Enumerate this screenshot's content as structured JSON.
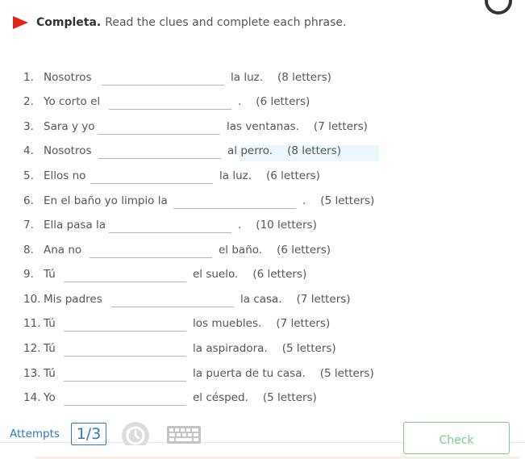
{
  "header": {
    "title": "Completa.",
    "instructions": "Read the clues and complete each phrase."
  },
  "items": [
    {
      "number": "1.",
      "before": "Nosotros",
      "after": "la luz.",
      "hint": "(8 letters)",
      "value": ""
    },
    {
      "number": "2.",
      "before": "Yo corto el",
      "after": ".",
      "hint": "(6 letters)",
      "value": ""
    },
    {
      "number": "3.",
      "before": "Sara y yo",
      "after": "las ventanas.",
      "hint": "(7 letters)",
      "value": ""
    },
    {
      "number": "4.",
      "before": "Nosotros",
      "after": "al perro.",
      "hint": "(8 letters)",
      "value": ""
    },
    {
      "number": "5.",
      "before": "Ellos no",
      "after": "la luz.",
      "hint": "(6 letters)",
      "value": ""
    },
    {
      "number": "6.",
      "before": "En el baño yo limpio la",
      "after": ".",
      "hint": "(5 letters)",
      "value": ""
    },
    {
      "number": "7.",
      "before": "Ella pasa la",
      "after": ".",
      "hint": "(10 letters)",
      "value": ""
    },
    {
      "number": "8.",
      "before": "Ana no",
      "after": "el baño.",
      "hint": "(6 letters)",
      "value": ""
    },
    {
      "number": "9.",
      "before": "Tú",
      "after": "el suelo.",
      "hint": "(6 letters)",
      "value": ""
    },
    {
      "number": "10.",
      "before": "Mis padres",
      "after": "la casa.",
      "hint": "(7 letters)",
      "value": ""
    },
    {
      "number": "11.",
      "before": "Tú",
      "after": "los muebles.",
      "hint": "(7 letters)",
      "value": ""
    },
    {
      "number": "12.",
      "before": "Tú",
      "after": "la aspiradora.",
      "hint": "(5 letters)",
      "value": ""
    },
    {
      "number": "13.",
      "before": "Tú",
      "after": "la puerta de tu casa.",
      "hint": "(5 letters)",
      "value": ""
    },
    {
      "number": "14.",
      "before": "Yo",
      "after": "el césped.",
      "hint": "(5 letters)",
      "value": ""
    }
  ],
  "footer": {
    "attempts_label": "Attempts",
    "attempts_value": "1/3",
    "check_label": "Check"
  },
  "icons": {
    "header": "red-flag-icon",
    "history": "history-icon",
    "keyboard": "keyboard-icon"
  },
  "colors": {
    "flag": "#e0241b",
    "link": "#2a78c6",
    "check": "#7fc88a",
    "text": "#555555"
  }
}
